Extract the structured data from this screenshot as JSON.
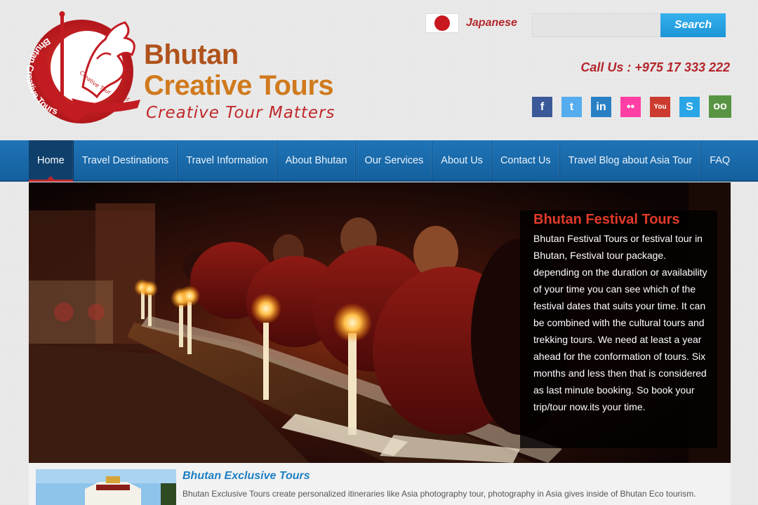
{
  "header": {
    "logo_ring_text": "Bhutan Creative Tours",
    "logo_inner_text": "Creative Tour Matters",
    "brand_line1": "Bhutan",
    "brand_line2": "Creative Tours",
    "tagline": "Creative Tour Matters",
    "language": {
      "label": "Japanese",
      "flag": "japan-flag-icon"
    },
    "search": {
      "placeholder": "",
      "button_label": "Search"
    },
    "call_text": "Call Us : +975 17 333 222",
    "socials": [
      {
        "name": "facebook-icon",
        "glyph": "f",
        "color": "#3b5998"
      },
      {
        "name": "twitter-icon",
        "glyph": "t",
        "color": "#55acee"
      },
      {
        "name": "linkedin-icon",
        "glyph": "in",
        "color": "#2a80c4"
      },
      {
        "name": "flickr-icon",
        "glyph": "••",
        "color": "#ff3fa4"
      },
      {
        "name": "youtube-icon",
        "glyph": "You",
        "color": "#cc3b2f"
      },
      {
        "name": "skype-icon",
        "glyph": "S",
        "color": "#2aa5e6"
      },
      {
        "name": "tripadvisor-icon",
        "glyph": "oo",
        "color": "#589442"
      }
    ]
  },
  "nav": {
    "items": [
      {
        "label": "Home",
        "active": true
      },
      {
        "label": "Travel Destinations"
      },
      {
        "label": "Travel Information"
      },
      {
        "label": "About Bhutan"
      },
      {
        "label": "Our Services"
      },
      {
        "label": "About Us"
      },
      {
        "label": "Contact Us"
      },
      {
        "label": "Travel Blog about Asia Tour"
      },
      {
        "label": "FAQ"
      }
    ]
  },
  "hero": {
    "title": "Bhutan Festival Tours",
    "text": "Bhutan Festival Tours or festival tour in Bhutan, Festival tour package. depending on the duration or availability of your time you can see which of the festival dates that suits your time. It can be combined with the cultural tours and trekking tours. We need at least a year ahead for the conformation of tours. Six months and less then that is considered as last minute booking. So book your trip/tour now.its your time."
  },
  "feature": {
    "title": "Bhutan Exclusive Tours",
    "description": "Bhutan Exclusive Tours create personalized itineraries like Asia photography tour, photography in Asia gives inside of Bhutan Eco tourism."
  },
  "colors": {
    "nav_blue": "#1f74b7",
    "brand_red": "#c0282a",
    "brand_orange": "#d07a1d",
    "search_blue": "#1d94d6"
  }
}
